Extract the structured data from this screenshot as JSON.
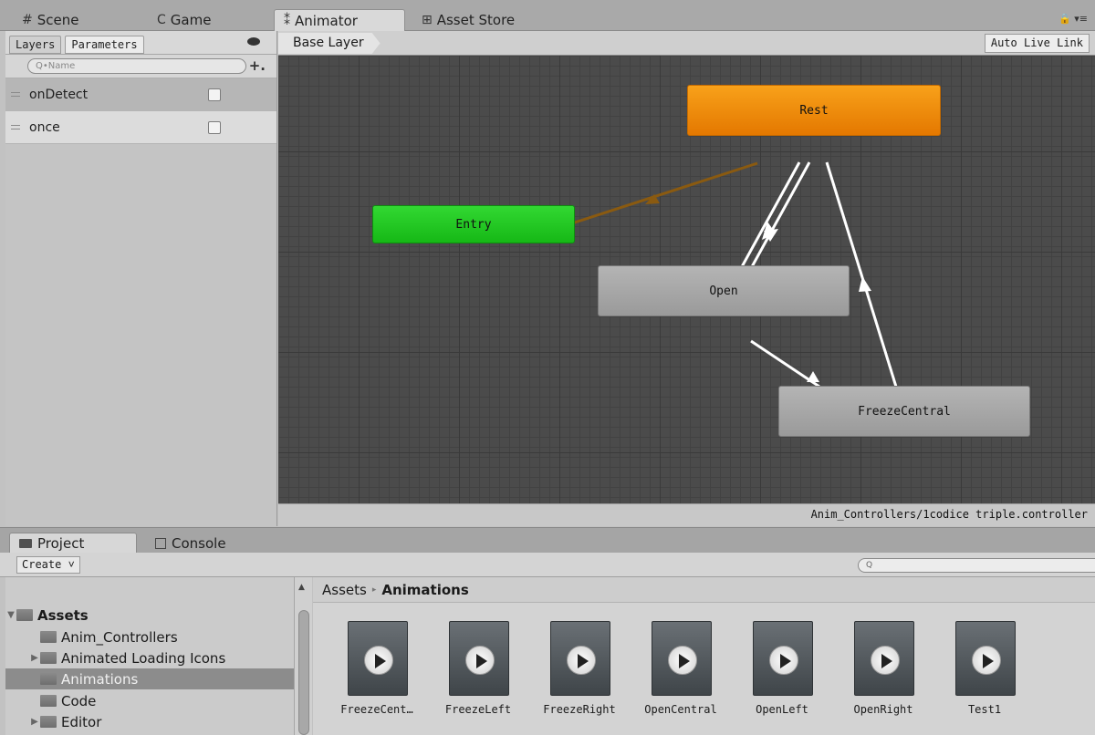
{
  "top_tabs": [
    {
      "label": "Scene",
      "glyph": "#"
    },
    {
      "label": "Game",
      "glyph": "C"
    },
    {
      "label": "Animator",
      "glyph": "⁑"
    },
    {
      "label": "Asset Store",
      "glyph": "⊞"
    }
  ],
  "left_panel": {
    "tabs": [
      "Layers",
      "Parameters"
    ],
    "search_placeholder": "Q•Name",
    "add_symbol": "+.",
    "parameters": [
      {
        "name": "onDetect",
        "checked": false
      },
      {
        "name": "once",
        "checked": false
      }
    ]
  },
  "animator": {
    "layer": "Base Layer",
    "auto_live_link": "Auto Live Link",
    "controller_path": "Anim_Controllers/1codice triple.controller",
    "states": {
      "rest": "Rest",
      "entry": "Entry",
      "open": "Open",
      "freeze": "FreezeCentral"
    },
    "colors": {
      "default_state": "#f39a12",
      "entry_state": "#22c922",
      "state": "#a8a8a8",
      "transition": "#ffffff",
      "default_transition": "#8a5a10"
    }
  },
  "bottom_tabs": [
    "Project",
    "Console"
  ],
  "toolbar": {
    "create_label": "Create ˅",
    "search_placeholder": "Q"
  },
  "tree": {
    "items": [
      {
        "label": "Assets",
        "arrow": "▼"
      },
      {
        "label": "Anim_Controllers",
        "arrow": ""
      },
      {
        "label": "Animated Loading Icons",
        "arrow": "▶"
      },
      {
        "label": "Animations",
        "arrow": ""
      },
      {
        "label": "Code",
        "arrow": ""
      },
      {
        "label": "Editor",
        "arrow": "▶"
      }
    ]
  },
  "breadcrumb": {
    "root": "Assets",
    "sep": "▸",
    "current": "Animations"
  },
  "assets": [
    "FreezeCent…",
    "FreezeLeft",
    "FreezeRight",
    "OpenCentral",
    "OpenLeft",
    "OpenRight",
    "Test1"
  ]
}
